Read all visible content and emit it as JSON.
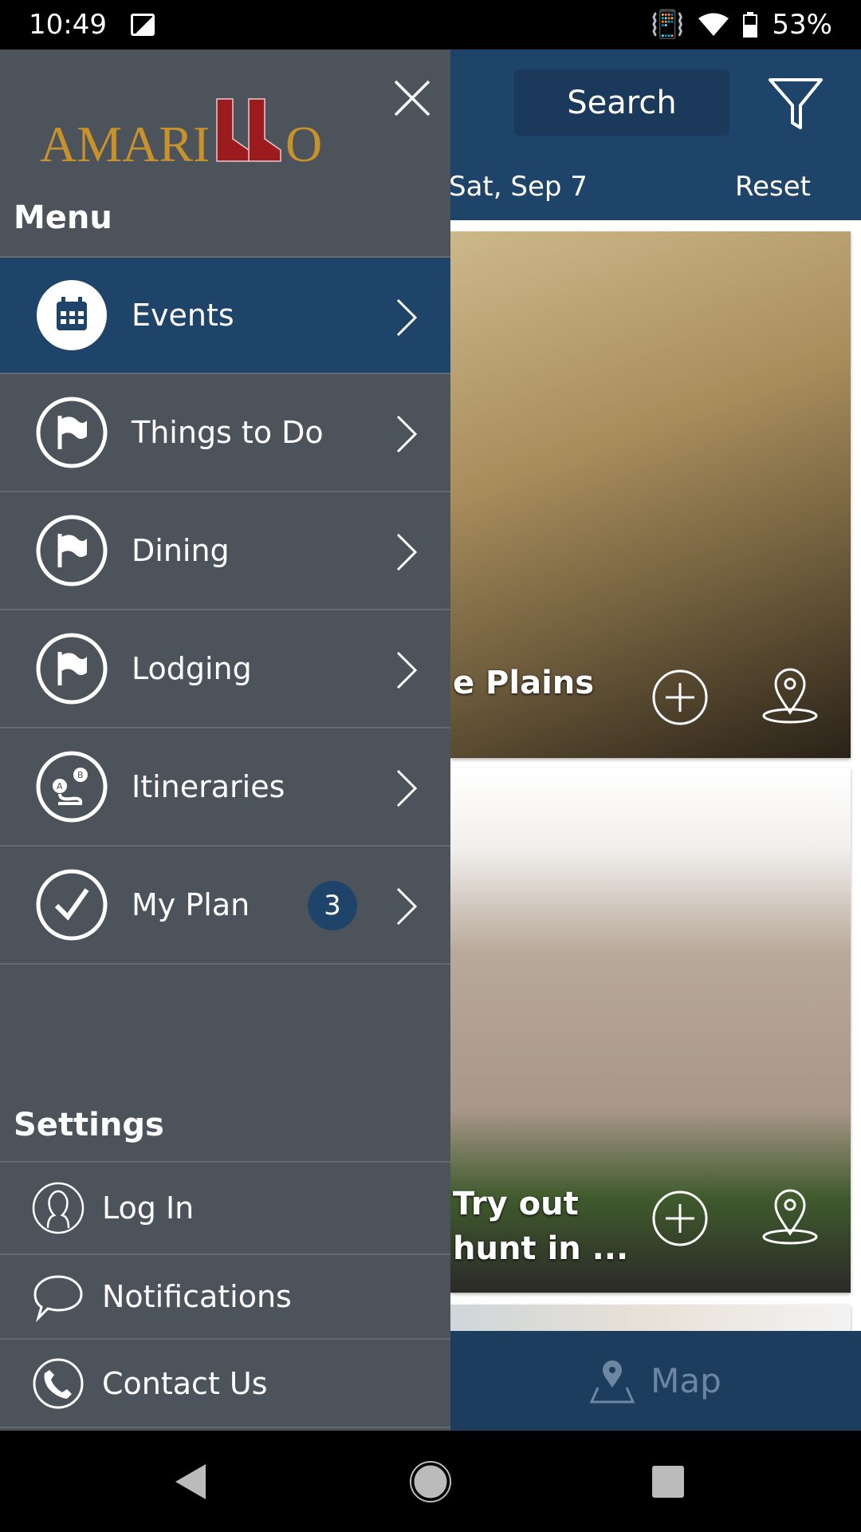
{
  "status_bar": {
    "time": "10:49",
    "battery": "53%"
  },
  "header": {
    "search_label": "Search",
    "date": "Sat, Sep 7",
    "reset_label": "Reset"
  },
  "cards": [
    {
      "title": "e Plains"
    },
    {
      "title_line1": "Try out",
      "title_line2": "hunt in ..."
    }
  ],
  "bottom_bar": {
    "map_label": "Map"
  },
  "drawer": {
    "logo_text": "AMARILLO",
    "menu_heading": "Menu",
    "menu_items": [
      {
        "label": "Events",
        "icon": "calendar-icon",
        "active": true
      },
      {
        "label": "Things to Do",
        "icon": "flag-icon"
      },
      {
        "label": "Dining",
        "icon": "flag-icon"
      },
      {
        "label": "Lodging",
        "icon": "flag-icon"
      },
      {
        "label": "Itineraries",
        "icon": "route-icon"
      },
      {
        "label": "My Plan",
        "icon": "check-icon",
        "badge": "3"
      }
    ],
    "settings_heading": "Settings",
    "settings_items": [
      {
        "label": "Log In",
        "icon": "user-icon"
      },
      {
        "label": "Notifications",
        "icon": "chat-bubble-icon"
      },
      {
        "label": "Contact Us",
        "icon": "phone-icon"
      }
    ]
  },
  "colors": {
    "drawer_bg": "#4d535b",
    "accent": "#1f4469",
    "logo_gold": "#c8922a",
    "logo_red": "#9b1b1e"
  }
}
